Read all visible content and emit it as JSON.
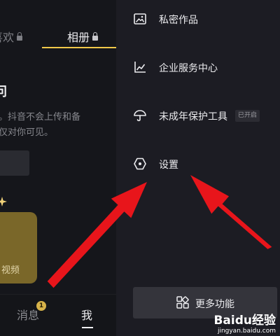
{
  "profile": {
    "tabs": [
      {
        "label": "喜欢"
      },
      {
        "label": "相册"
      }
    ],
    "section_heading": "问",
    "description_lines": [
      "。抖音不会上传和备",
      "仅对你可见。"
    ],
    "button_label": "",
    "video_card_label": "视频",
    "bottom_nav": {
      "messages_label": "消息",
      "messages_badge": "1",
      "me_label": "我"
    }
  },
  "drawer": {
    "items": [
      {
        "label": "私密作品",
        "icon": "private-photo-icon"
      },
      {
        "label": "企业服务中心",
        "icon": "chart-line-icon"
      },
      {
        "label": "未成年保护工具",
        "icon": "umbrella-icon",
        "status": "已开启"
      },
      {
        "label": "设置",
        "icon": "hexagon-settings-icon"
      }
    ],
    "more_label": "更多功能",
    "more_icon": "grid-icon"
  },
  "watermark": {
    "brand": "Baidu经验",
    "url": "jingyan.baidu.com"
  },
  "colors": {
    "drawer_bg": "#1c1c23",
    "accent_gold": "#f1c84a",
    "annotation_arrow": "#e8151b"
  }
}
